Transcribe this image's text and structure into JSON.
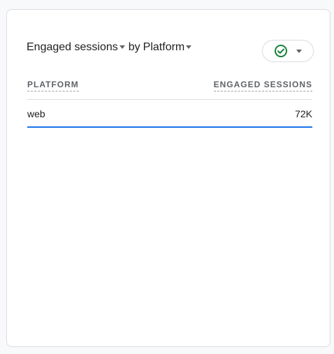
{
  "card": {
    "title": {
      "metric": "Engaged sessions",
      "connector": "by",
      "dimension": "Platform"
    },
    "compare_button": {
      "icon": "check-circle-icon",
      "accent_color": "#188038"
    },
    "table": {
      "columns": [
        "PLATFORM",
        "ENGAGED SESSIONS"
      ],
      "rows": [
        {
          "platform": "web",
          "engaged_sessions": "72K"
        }
      ],
      "bar_color": "#1a73e8"
    }
  }
}
